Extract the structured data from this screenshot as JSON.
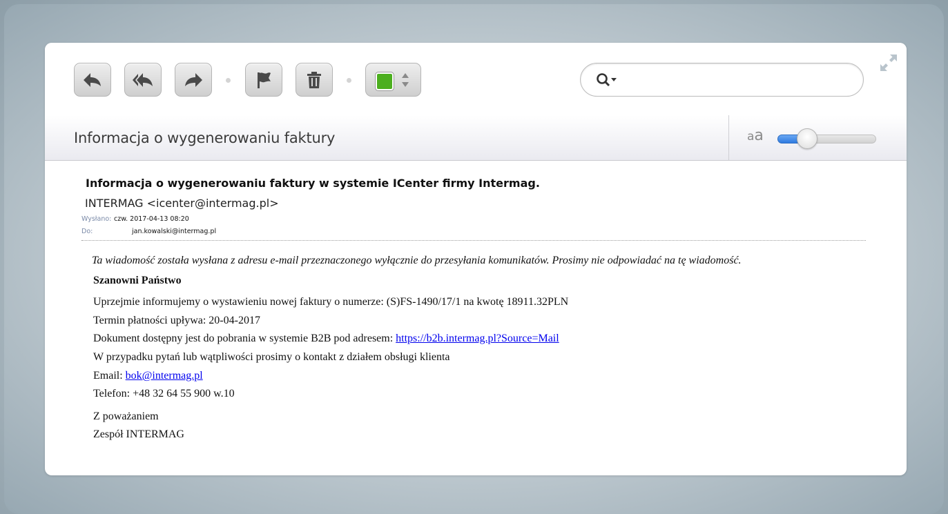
{
  "toolbar": {
    "buttons": [
      {
        "name": "reply",
        "icon": "reply-icon"
      },
      {
        "name": "reply-all",
        "icon": "reply-all-icon"
      },
      {
        "name": "forward",
        "icon": "forward-icon"
      },
      {
        "name": "flag",
        "icon": "flag-icon"
      },
      {
        "name": "delete",
        "icon": "trash-icon"
      }
    ],
    "category_color": "#4caf1f",
    "search": {
      "value": "",
      "placeholder": ""
    }
  },
  "header": {
    "subject": "Informacja o wygenerowaniu faktury",
    "font_size_label": "aA",
    "font_size_level": 0.25
  },
  "message": {
    "title": "Informacja o wygenerowaniu faktury w systemie ICenter firmy Intermag.",
    "sender": "INTERMAG <icenter@intermag.pl>",
    "sent_label": "Wysłano:",
    "sent_value": "czw. 2017-04-13 08:20",
    "to_label": "Do:",
    "to_value": "jan.kowalski@intermag.pl",
    "notice": "Ta wiadomość została wysłana z adresu e-mail przeznaczonego wyłącznie do przesyłania komunikatów. Prosimy nie odpowiadać na tę wiadomość.",
    "greeting": "Szanowni Państwo",
    "line_invoice": "Uprzejmie informujemy o wystawieniu nowej faktury o numerze: (S)FS-1490/17/1 na kwotę 18911.32PLN",
    "line_due": "Termin płatności upływa: 20-04-2017",
    "line_download_prefix": "Dokument dostępny jest do pobrania w systemie B2B pod adresem: ",
    "download_link": "https://b2b.intermag.pl?Source=Mail",
    "line_contact": "W przypadku pytań lub wątpliwości prosimy o kontakt z działem obsługi klienta",
    "email_prefix": "Email: ",
    "email_link": "bok@intermag.pl",
    "phone": "Telefon: +48 32 64 55 900 w.10",
    "closing": "Z poważaniem",
    "signature": "Zespół INTERMAG"
  }
}
